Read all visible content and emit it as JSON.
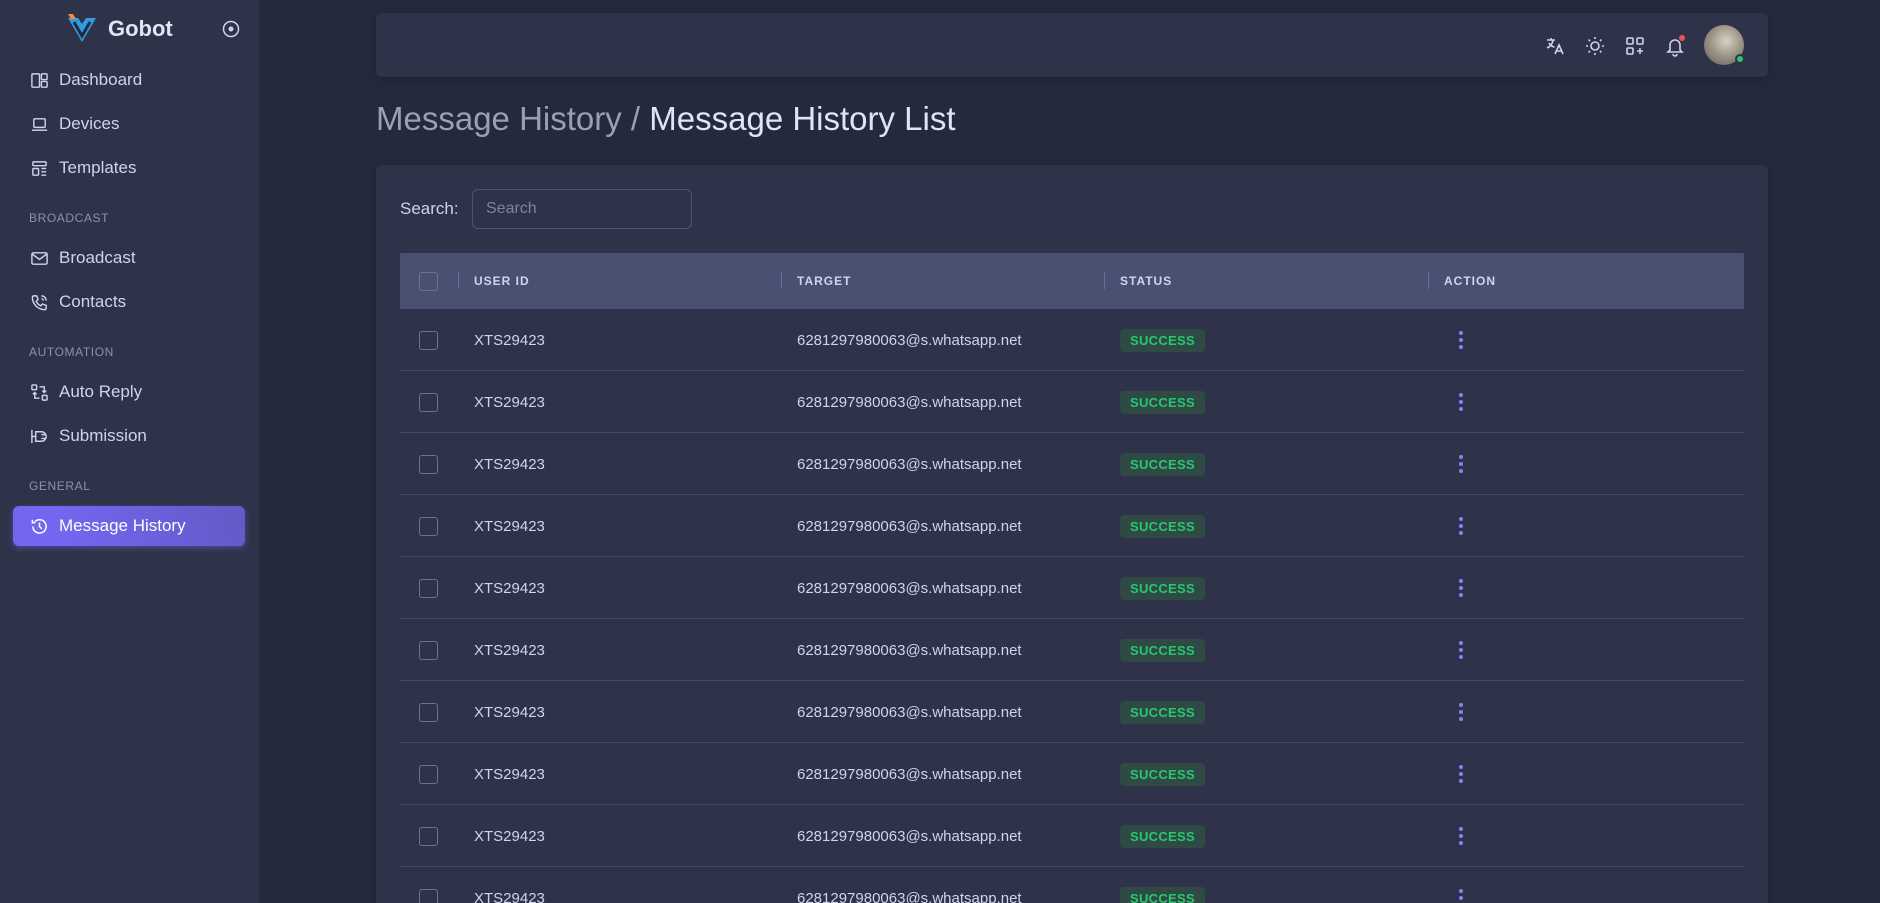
{
  "app": {
    "name": "Gobot"
  },
  "sidebar": {
    "items_top": [
      {
        "label": "Dashboard",
        "icon": "dashboard-icon"
      },
      {
        "label": "Devices",
        "icon": "laptop-icon"
      },
      {
        "label": "Templates",
        "icon": "template-icon"
      }
    ],
    "sections": {
      "broadcast": "BROADCAST",
      "automation": "AUTOMATION",
      "general": "GENERAL"
    },
    "broadcast_items": [
      {
        "label": "Broadcast",
        "icon": "mail-icon"
      },
      {
        "label": "Contacts",
        "icon": "phone-icon"
      }
    ],
    "automation_items": [
      {
        "label": "Auto Reply",
        "icon": "arrows-exchange-icon"
      },
      {
        "label": "Submission",
        "icon": "plug-icon"
      }
    ],
    "general_items": [
      {
        "label": "Message History",
        "icon": "history-icon",
        "active": true
      }
    ]
  },
  "breadcrumb": {
    "parent": "Message History",
    "separator": " / ",
    "current": "Message History List"
  },
  "search": {
    "label": "Search:",
    "placeholder": "Search",
    "value": ""
  },
  "table": {
    "columns": [
      "USER ID",
      "TARGET",
      "STATUS",
      "ACTION"
    ],
    "rows": [
      {
        "user_id": "XTS29423",
        "target": "6281297980063@s.whatsapp.net",
        "status": "SUCCESS"
      },
      {
        "user_id": "XTS29423",
        "target": "6281297980063@s.whatsapp.net",
        "status": "SUCCESS"
      },
      {
        "user_id": "XTS29423",
        "target": "6281297980063@s.whatsapp.net",
        "status": "SUCCESS"
      },
      {
        "user_id": "XTS29423",
        "target": "6281297980063@s.whatsapp.net",
        "status": "SUCCESS"
      },
      {
        "user_id": "XTS29423",
        "target": "6281297980063@s.whatsapp.net",
        "status": "SUCCESS"
      },
      {
        "user_id": "XTS29423",
        "target": "6281297980063@s.whatsapp.net",
        "status": "SUCCESS"
      },
      {
        "user_id": "XTS29423",
        "target": "6281297980063@s.whatsapp.net",
        "status": "SUCCESS"
      },
      {
        "user_id": "XTS29423",
        "target": "6281297980063@s.whatsapp.net",
        "status": "SUCCESS"
      },
      {
        "user_id": "XTS29423",
        "target": "6281297980063@s.whatsapp.net",
        "status": "SUCCESS"
      },
      {
        "user_id": "XTS29423",
        "target": "6281297980063@s.whatsapp.net",
        "status": "SUCCESS"
      }
    ]
  },
  "colors": {
    "accent": "#7367f0",
    "success": "#28c76f",
    "notification": "#ea5455",
    "background": "#25293c",
    "surface": "#2f3349"
  },
  "navbar_icons": [
    "translate-icon",
    "sun-icon",
    "apps-add-icon",
    "bell-icon"
  ]
}
